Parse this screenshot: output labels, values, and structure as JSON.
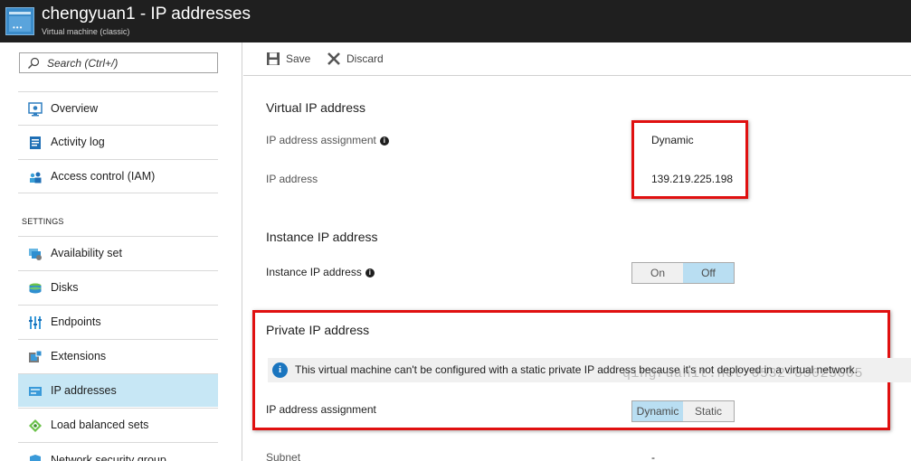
{
  "header": {
    "title": "chengyuan1 - IP addresses",
    "subtitle": "Virtual machine (classic)",
    "icon": "virtual-machine-icon"
  },
  "sidebar": {
    "search_placeholder": "Search (Ctrl+/)",
    "items": [
      {
        "label": "Overview",
        "icon": "overview-icon"
      },
      {
        "label": "Activity log",
        "icon": "activity-log-icon"
      },
      {
        "label": "Access control (IAM)",
        "icon": "access-control-icon"
      }
    ],
    "settings_label": "SETTINGS",
    "settings_items": [
      {
        "label": "Availability set",
        "icon": "availability-set-icon"
      },
      {
        "label": "Disks",
        "icon": "disks-icon"
      },
      {
        "label": "Endpoints",
        "icon": "endpoints-icon"
      },
      {
        "label": "Extensions",
        "icon": "extensions-icon"
      },
      {
        "label": "IP addresses",
        "icon": "ip-addresses-icon",
        "selected": true
      },
      {
        "label": "Load balanced sets",
        "icon": "load-balanced-sets-icon"
      },
      {
        "label": "Network security group",
        "icon": "network-security-group-icon"
      }
    ]
  },
  "toolbar": {
    "save_label": "Save",
    "discard_label": "Discard"
  },
  "virtual_ip": {
    "title": "Virtual IP address",
    "assignment_label": "IP address assignment",
    "assignment_value": "Dynamic",
    "ip_label": "IP address",
    "ip_value": "139.219.225.198"
  },
  "instance_ip": {
    "title": "Instance IP address",
    "label": "Instance IP address",
    "on_label": "On",
    "off_label": "Off",
    "selected": "Off"
  },
  "private_ip": {
    "title": "Private IP address",
    "banner_text": "This virtual machine can't be configured with a static private IP address because it's not deployed in a virtual network.",
    "assignment_label": "IP address assignment",
    "dynamic_label": "Dynamic",
    "static_label": "Static",
    "selected": "Dynamic",
    "subnet_label": "Subnet",
    "subnet_value": "-"
  },
  "watermark": "qingruanit.net 0532-85025005",
  "colors": {
    "header_bg": "#1f1f1f",
    "selected_nav": "#c7e7f5",
    "toggle_active": "#b9def2",
    "highlight_border": "#e01010",
    "info_blue": "#1a75bf"
  }
}
